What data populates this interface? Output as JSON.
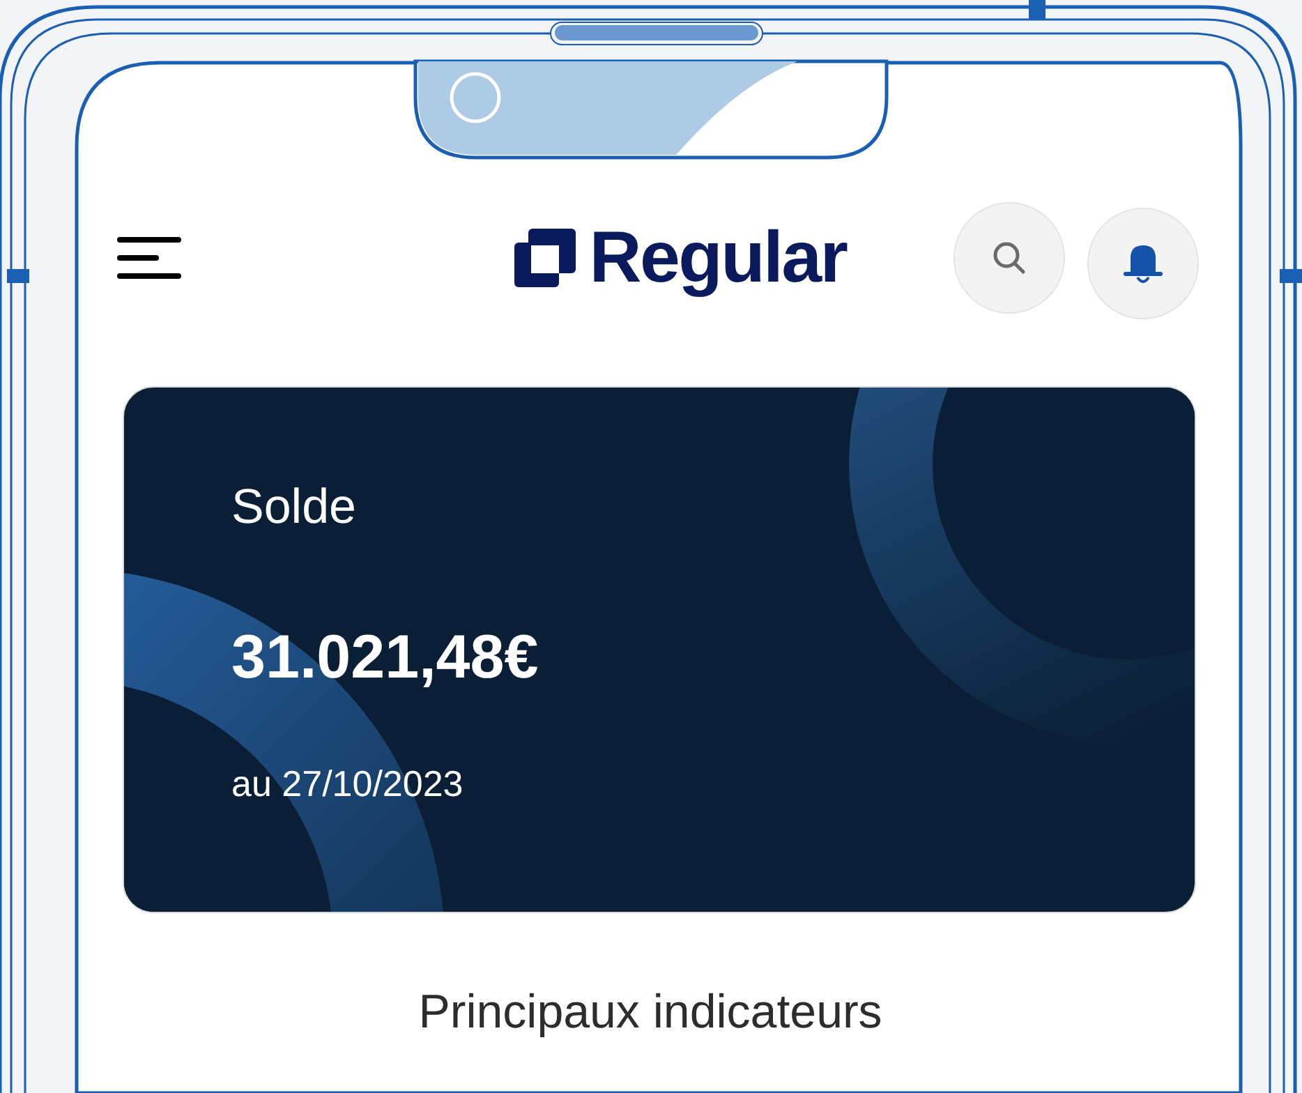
{
  "header": {
    "logo": "Regular"
  },
  "balance_card": {
    "label": "Solde",
    "amount": "31.021,48€",
    "date": "au 27/10/2023"
  },
  "section_title": "Principaux indicateurs"
}
